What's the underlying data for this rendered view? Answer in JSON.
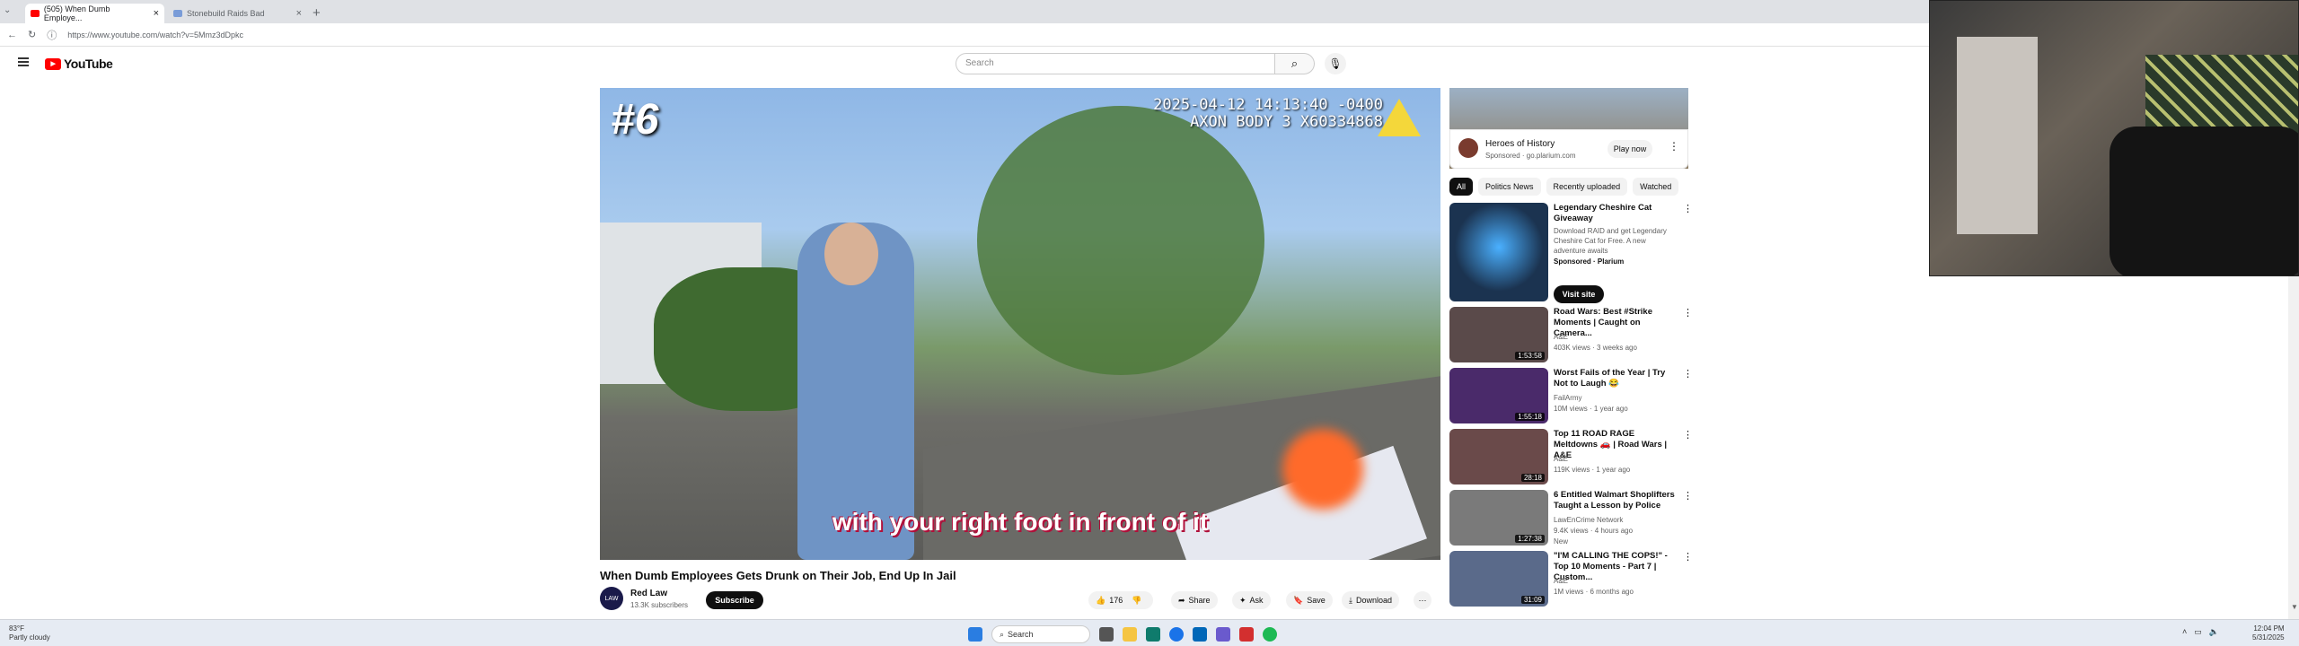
{
  "browser": {
    "tabs": [
      {
        "label": "(505) When Dumb Employe...",
        "active": true,
        "favicon_color": "#ff0000"
      },
      {
        "label": "Stonebuild Raids Bad",
        "active": false,
        "favicon_color": "#7a9cd8"
      }
    ],
    "new_tab": "+",
    "url": "https://www.youtube.com/watch?v=5Mmz3dDpkc"
  },
  "youtube": {
    "logo_text": "YouTube",
    "search_placeholder": "Search"
  },
  "player": {
    "overlay_number": "#6",
    "timestamp_line1": "2025-04-12 14:13:40 -0400",
    "timestamp_line2": "AXON BODY 3 X60334868",
    "caption": "with your right foot in front of it"
  },
  "video": {
    "title": "When Dumb Employees Gets Drunk on Their Job, End Up In Jail",
    "channel": "Red Law",
    "subscribers": "13.3K subscribers",
    "avatar_text": "LAW",
    "subscribe_label": "Subscribe",
    "like_count": "176",
    "share_label": "Share",
    "ask_label": "Ask",
    "save_label": "Save",
    "download_label": "Download",
    "more": "⋯"
  },
  "ad": {
    "title": "Heroes of History",
    "sponsor": "Sponsored · go.plarium.com",
    "play_label": "Play now"
  },
  "chips": [
    "All",
    "Politics News",
    "Recently uploaded",
    "Watched"
  ],
  "recommendations": [
    {
      "title": "Legendary Cheshire Cat Giveaway",
      "meta1": "Download RAID and get Legendary Cheshire Cat for Free. A new",
      "meta2": "adventure awaits",
      "meta3": "Sponsored · Plarium",
      "duration": "",
      "visit_label": "Visit site",
      "thumb": "#1b3350"
    },
    {
      "title": "Road Wars: Best #Strike Moments | Caught on Camera...",
      "meta1": "A&E",
      "meta2": "403K views · 3 weeks ago",
      "meta3": "",
      "duration": "1:53:58",
      "thumb": "#5a4a4a"
    },
    {
      "title": "Worst Fails of the Year | Try Not to Laugh 😂",
      "meta1": "FailArmy",
      "meta2": "10M views · 1 year ago",
      "meta3": "",
      "duration": "1:55:18",
      "thumb": "#4a2a6a"
    },
    {
      "title": "Top 11 ROAD RAGE Meltdowns 🚗 | Road Wars | A&E",
      "meta1": "A&E",
      "meta2": "119K views · 1 year ago",
      "meta3": "",
      "duration": "28:18",
      "thumb": "#6a4a4a"
    },
    {
      "title": "6 Entitled Walmart Shoplifters Taught a Lesson by Police",
      "meta1": "LawEnCrime Network",
      "meta2": "9.4K views · 4 hours ago",
      "meta3": "New",
      "duration": "1:27:38",
      "thumb": "#7a7a7a"
    },
    {
      "title": "\"I'M CALLING THE COPS!\" - Top 10 Moments - Part 7 | Custom...",
      "meta1": "A&E",
      "meta2": "1M views · 6 months ago",
      "meta3": "",
      "duration": "31:09",
      "thumb": "#5a6a8a"
    }
  ],
  "taskbar": {
    "weather_temp": "83°F",
    "weather_desc": "Partly cloudy",
    "search_label": "Search",
    "time": "12:04 PM",
    "date": "5/31/2025"
  }
}
